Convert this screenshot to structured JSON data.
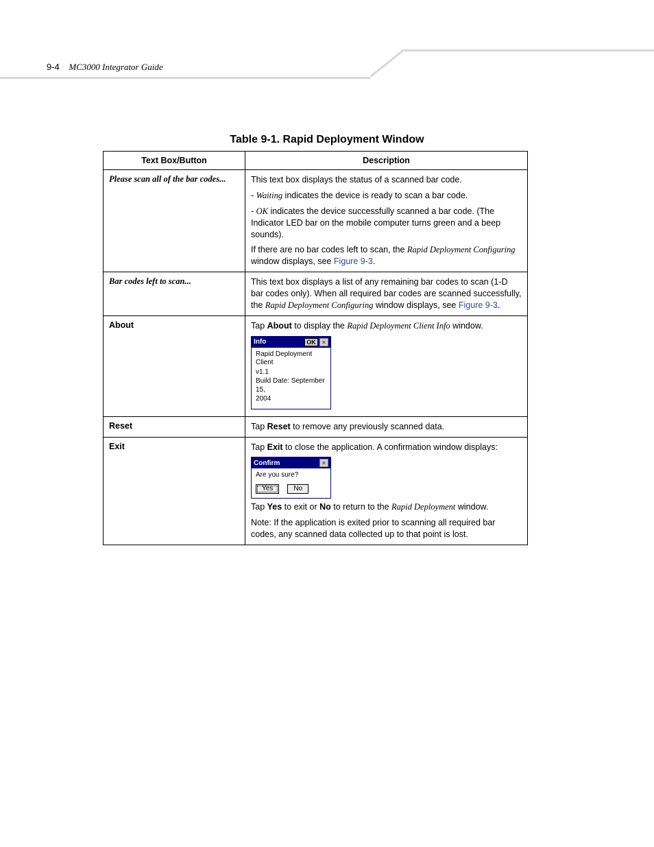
{
  "header": {
    "page_num": "9-4",
    "doc_title": "MC3000 Integrator Guide"
  },
  "caption": "Table 9-1. Rapid Deployment Window",
  "col_headers": {
    "c1": "Text Box/Button",
    "c2": "Description"
  },
  "rows": {
    "r1": {
      "label": "Please scan all of the bar codes...",
      "p1": "This text box displays the status of a scanned bar code.",
      "p2_pre": "- ",
      "p2_em": "Waiting",
      "p2_post": " indicates the device is ready to scan a bar code.",
      "p3_pre": "- ",
      "p3_em": "OK",
      "p3_post": " indicates the device successfully scanned a bar code. (The Indicator LED bar on the mobile computer turns green and a beep sounds).",
      "p4_pre": "If there are no bar codes left to scan, the ",
      "p4_em": "Rapid Deployment Configuring",
      "p4_mid": " window displays, see ",
      "p4_link": "Figure 9-3",
      "p4_end": "."
    },
    "r2": {
      "label": "Bar codes left to scan...",
      "p1_pre": "This text box displays a list of any remaining bar codes to scan (1-D bar codes only). When all required bar codes are scanned successfully, the ",
      "p1_em": "Rapid Deployment Configuring",
      "p1_mid": " window displays, see ",
      "p1_link": "Figure 9-3",
      "p1_end": "."
    },
    "r3": {
      "label": "About",
      "p1_pre": "Tap ",
      "p1_b": "About",
      "p1_mid": " to display the ",
      "p1_em": "Rapid Deployment Client Info",
      "p1_end": " window.",
      "dlg": {
        "title": "Info",
        "ok": "OK",
        "l1": "Rapid Deployment Client",
        "l2": "v1.1",
        "l3": "Build Date: September 15,",
        "l4": "2004"
      }
    },
    "r4": {
      "label": "Reset",
      "p1_pre": "Tap ",
      "p1_b": "Reset",
      "p1_end": " to remove any previously scanned data."
    },
    "r5": {
      "label": "Exit",
      "p1_pre": "Tap ",
      "p1_b": "Exit",
      "p1_end": " to close the application. A confirmation window displays:",
      "dlg": {
        "title": "Confirm",
        "body": "Are you sure?",
        "yes": "Yes",
        "no": "No"
      },
      "p2_pre": "Tap ",
      "p2_b1": "Yes",
      "p2_mid1": " to exit or ",
      "p2_b2": "No",
      "p2_mid2": " to return to the ",
      "p2_em": "Rapid Deployment",
      "p2_end": " window.",
      "p3": "Note: If the application is exited prior to scanning all required bar codes, any scanned data collected up to that point is lost."
    }
  }
}
